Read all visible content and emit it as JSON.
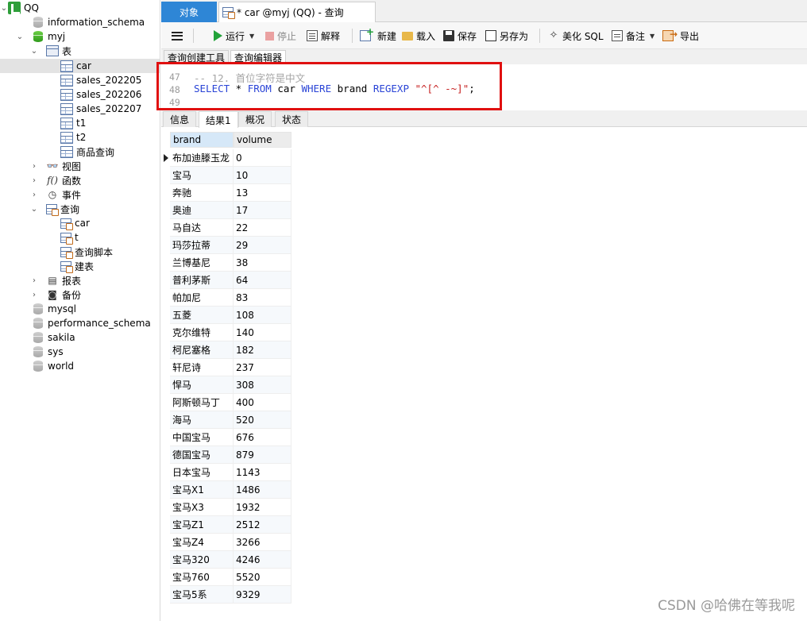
{
  "navigator": {
    "connection": "QQ",
    "databases": [
      "information_schema",
      "myj",
      "mysql",
      "performance_schema",
      "sakila",
      "sys",
      "world"
    ],
    "myj_groups": {
      "tables": "表",
      "views": "视图",
      "functions": "函数",
      "events": "事件",
      "queries": "查询",
      "reports": "报表",
      "backups": "备份"
    },
    "tables": [
      "car",
      "sales_202205",
      "sales_202206",
      "sales_202207",
      "t1",
      "t2",
      "商品查询"
    ],
    "queries": [
      "car",
      "t",
      "查询脚本",
      "建表"
    ],
    "selected_table": "car"
  },
  "tabs": {
    "objects": "对象",
    "query": "* car @myj (QQ) - 查询"
  },
  "toolbar": {
    "run": "运行",
    "stop": "停止",
    "explain": "解释",
    "new": "新建",
    "load": "载入",
    "save": "保存",
    "save_as": "另存为",
    "beautify": "美化 SQL",
    "note": "备注",
    "export": "导出"
  },
  "editor_tabs": {
    "builder": "查询创建工具",
    "editor": "查询编辑器"
  },
  "editor": {
    "lines": [
      {
        "num": "47",
        "comment": "-- 12. 首位字符是中文"
      },
      {
        "num": "48",
        "kw1": "SELECT",
        "t1": " * ",
        "kw2": "FROM",
        "t2": " car ",
        "kw3": "WHERE",
        "t3": " brand ",
        "kw4": "REGEXP",
        "t4": " ",
        "str": "\"^[^ -~]\"",
        "t5": ";"
      },
      {
        "num": "49"
      }
    ]
  },
  "result_tabs": {
    "info": "信息",
    "result1": "结果1",
    "overview": "概况",
    "status": "状态"
  },
  "grid": {
    "columns": [
      "brand",
      "volume"
    ],
    "rows": [
      [
        "布加迪滕玉龙",
        "0"
      ],
      [
        "宝马",
        "10"
      ],
      [
        "奔驰",
        "13"
      ],
      [
        "奥迪",
        "17"
      ],
      [
        "马自达",
        "22"
      ],
      [
        "玛莎拉蒂",
        "29"
      ],
      [
        "兰博基尼",
        "38"
      ],
      [
        "普利茅斯",
        "64"
      ],
      [
        "帕加尼",
        "83"
      ],
      [
        "五菱",
        "108"
      ],
      [
        "克尔维特",
        "140"
      ],
      [
        "柯尼塞格",
        "182"
      ],
      [
        "轩尼诗",
        "237"
      ],
      [
        "悍马",
        "308"
      ],
      [
        "阿斯顿马丁",
        "400"
      ],
      [
        "海马",
        "520"
      ],
      [
        "中国宝马",
        "676"
      ],
      [
        "德国宝马",
        "879"
      ],
      [
        "日本宝马",
        "1143"
      ],
      [
        "宝马X1",
        "1486"
      ],
      [
        "宝马X3",
        "1932"
      ],
      [
        "宝马Z1",
        "2512"
      ],
      [
        "宝马Z4",
        "3266"
      ],
      [
        "宝马320",
        "4246"
      ],
      [
        "宝马760",
        "5520"
      ],
      [
        "宝马5系",
        "9329"
      ]
    ]
  },
  "watermark": "CSDN @哈佛在等我呢"
}
